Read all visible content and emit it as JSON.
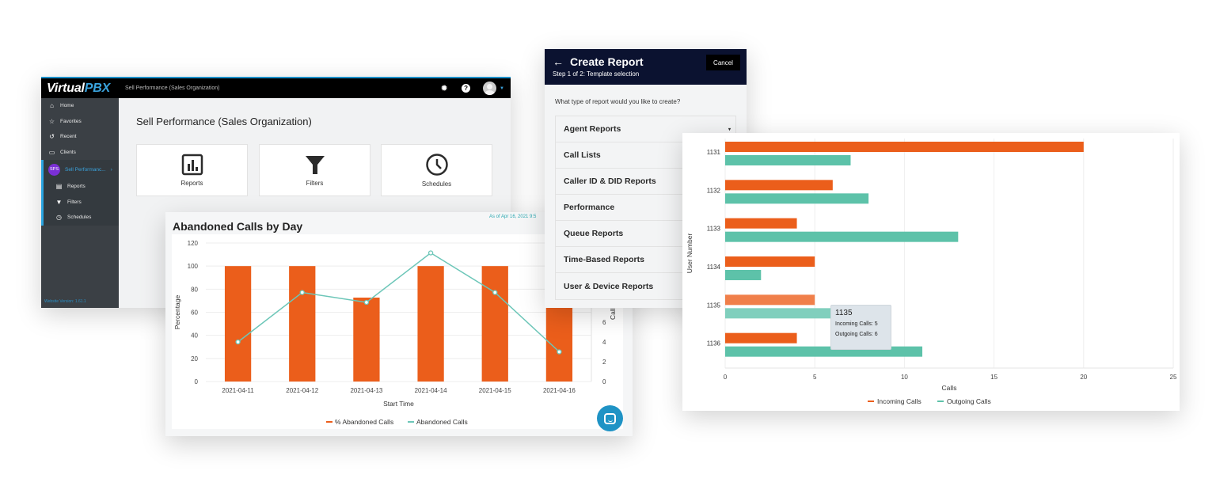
{
  "app": {
    "logo_text": "Virtual",
    "logo_accent": "PBX",
    "top_title": "Sell Performance (Sales Organization)",
    "icons": [
      "gear-icon",
      "help-icon",
      "avatar"
    ],
    "sidebar": {
      "items": [
        {
          "label": "Home",
          "icon": "home-icon"
        },
        {
          "label": "Favorites",
          "icon": "star-icon"
        },
        {
          "label": "Recent",
          "icon": "history-icon"
        },
        {
          "label": "Clients",
          "icon": "devices-icon"
        }
      ],
      "active": {
        "badge": "SPS",
        "label": "Sell Performanc...",
        "arrow": "›"
      },
      "subitems": [
        {
          "label": "Reports",
          "icon": "report-icon"
        },
        {
          "label": "Filters",
          "icon": "filter-icon"
        },
        {
          "label": "Schedules",
          "icon": "clock-icon"
        }
      ],
      "version": "Website Version: 1.61.1"
    },
    "page_title": "Sell Performance (Sales Organization)",
    "tiles": [
      {
        "label": "Reports",
        "icon": "bar-chart-icon"
      },
      {
        "label": "Filters",
        "icon": "filter-icon"
      },
      {
        "label": "Schedules",
        "icon": "clock-icon"
      }
    ]
  },
  "abandoned": {
    "title": "Abandoned Calls by Day",
    "as_of": "As of Apr 16, 2021 9:5",
    "chat_icon": "chat-icon"
  },
  "create_report": {
    "back_icon": "←",
    "title": "Create Report",
    "subtitle": "Step 1 of 2: Template selection",
    "cancel_label": "Cancel",
    "question": "What type of report would you like to create?",
    "options": [
      "Agent Reports",
      "Call Lists",
      "Caller ID & DID Reports",
      "Performance",
      "Queue Reports",
      "Time-Based Reports",
      "User & Device Reports"
    ],
    "dropdown_icon": "▾"
  },
  "tooltip": {
    "title": "1135",
    "rows": [
      "Incoming Calls: 5",
      "Outgoing Calls: 6"
    ]
  },
  "chart_data": [
    {
      "type": "bar",
      "title": "Abandoned Calls by Day",
      "categories": [
        "2021-04-11",
        "2021-04-12",
        "2021-04-13",
        "2021-04-14",
        "2021-04-15",
        "2021-04-16"
      ],
      "series": [
        {
          "name": "% Abandoned Calls",
          "type": "bar",
          "axis": "left",
          "color": "#eb5e1b",
          "values": [
            100,
            100,
            72.7,
            100,
            100,
            100
          ]
        },
        {
          "name": "Abandoned Calls",
          "type": "line",
          "axis": "right",
          "color": "#6cc6b8",
          "values": [
            4,
            9,
            8,
            13,
            9,
            3
          ]
        }
      ],
      "xlabel": "Start Time",
      "ylabel": "Percentage",
      "y2label": "Calls",
      "ylim": [
        0,
        120
      ],
      "yticks": [
        0,
        20,
        40,
        60,
        80,
        100,
        120
      ],
      "y2ticks": [
        0,
        2,
        4,
        6
      ],
      "y2lim": [
        0,
        14
      ],
      "grid": true,
      "legend": "bottom"
    },
    {
      "type": "bar",
      "orientation": "horizontal",
      "categories": [
        "1131",
        "1132",
        "1133",
        "1134",
        "1135",
        "1136"
      ],
      "series": [
        {
          "name": "Incoming Calls",
          "color": "#eb5e1b",
          "values": [
            20,
            6,
            4,
            5,
            5,
            4
          ]
        },
        {
          "name": "Outgoing Calls",
          "color": "#5dc2a9",
          "values": [
            7,
            8,
            13,
            2,
            6,
            11
          ]
        }
      ],
      "xlabel": "Calls",
      "ylabel": "User Number",
      "xlim": [
        0,
        25
      ],
      "xticks": [
        0,
        5,
        10,
        15,
        20,
        25
      ],
      "highlighted": "1135",
      "grid": true,
      "legend": "bottom"
    }
  ]
}
